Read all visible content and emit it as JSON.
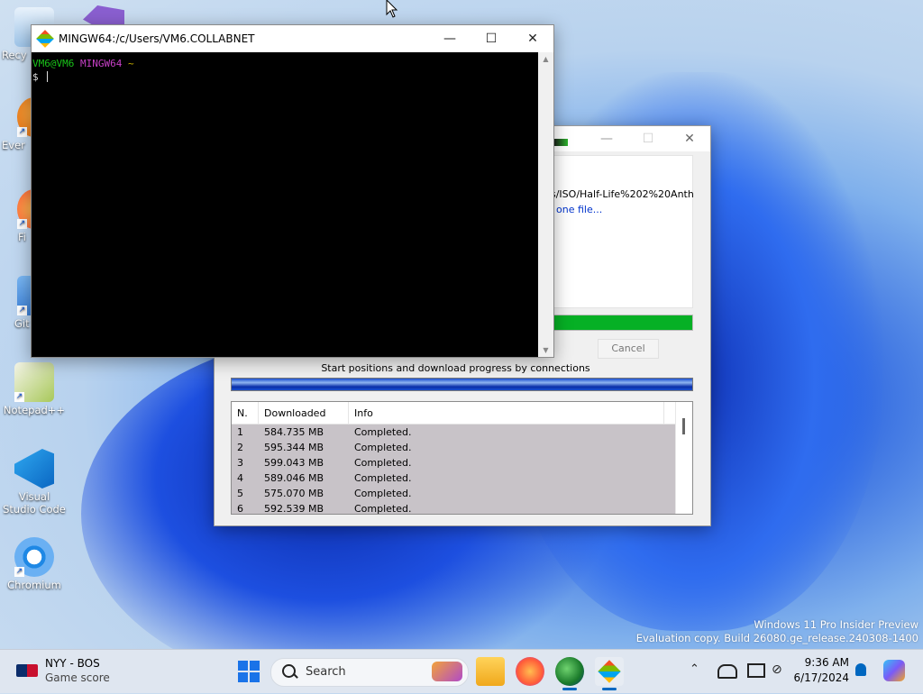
{
  "desktop": {
    "icons": [
      {
        "label": "Recy"
      },
      {
        "label": "Ever"
      },
      {
        "label": "Fi"
      },
      {
        "label": "Git"
      },
      {
        "label": "Notepad++"
      },
      {
        "label": "Visual Studio Code"
      },
      {
        "label": "Chromium"
      }
    ],
    "watermark_line1": "Windows 11 Pro Insider Preview",
    "watermark_line2": "Evaluation copy. Build 26080.ge_release.240308-1400"
  },
  "terminal": {
    "title": "MINGW64:/c/Users/VM6.COLLABNET",
    "prompt_user": "VM6@VM6",
    "prompt_env": "MINGW64",
    "prompt_path": "~",
    "prompt_symbol": "$"
  },
  "downloader": {
    "url_fragment": "s/ISO/Half-Life%202%20Anth",
    "link_fragment": "one file...",
    "progress": 1.0,
    "cancel_label": "Cancel",
    "connections_caption": "Start positions and download progress by connections",
    "table": {
      "headers": [
        "N.",
        "Downloaded",
        "Info"
      ],
      "rows": [
        {
          "n": "1",
          "downloaded": "584.735  MB",
          "info": "Completed."
        },
        {
          "n": "2",
          "downloaded": "595.344  MB",
          "info": "Completed."
        },
        {
          "n": "3",
          "downloaded": "599.043  MB",
          "info": "Completed."
        },
        {
          "n": "4",
          "downloaded": "589.046  MB",
          "info": "Completed."
        },
        {
          "n": "5",
          "downloaded": "575.070  MB",
          "info": "Completed."
        },
        {
          "n": "6",
          "downloaded": "592.539  MB",
          "info": "Completed."
        }
      ]
    }
  },
  "taskbar": {
    "widget_title": "NYY - BOS",
    "widget_subtitle": "Game score",
    "search_placeholder": "Search",
    "time": "9:36 AM",
    "date": "6/17/2024"
  }
}
